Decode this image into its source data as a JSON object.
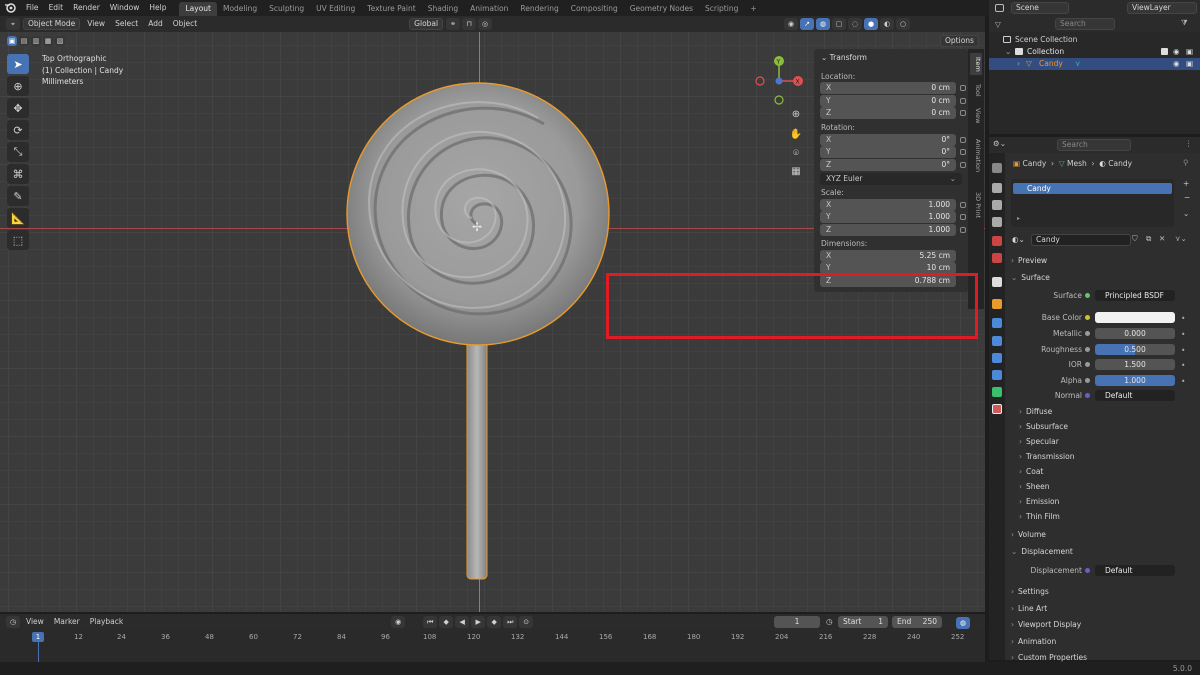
{
  "topbar": {
    "menus": [
      "File",
      "Edit",
      "Render",
      "Window",
      "Help"
    ],
    "workspaces": [
      "Layout",
      "Modeling",
      "Sculpting",
      "UV Editing",
      "Texture Paint",
      "Shading",
      "Animation",
      "Rendering",
      "Compositing",
      "Geometry Nodes",
      "Scripting"
    ],
    "add_tab": "+",
    "scene": "Scene",
    "view_layer": "ViewLayer"
  },
  "viewport_header": {
    "mode": "Object Mode",
    "menus": [
      "View",
      "Select",
      "Add",
      "Object"
    ],
    "orientation": "Global",
    "options": "Options"
  },
  "viewport": {
    "view_name": "Top Orthographic",
    "collection_info": "(1) Collection | Candy",
    "units": "Millimeters",
    "gizmo": {
      "x": "X",
      "y": "Y"
    }
  },
  "npanel": {
    "title": "Transform",
    "location_label": "Location:",
    "location": [
      {
        "axis": "X",
        "value": "0 cm"
      },
      {
        "axis": "Y",
        "value": "0 cm"
      },
      {
        "axis": "Z",
        "value": "0 cm"
      }
    ],
    "rotation_label": "Rotation:",
    "rotation": [
      {
        "axis": "X",
        "value": "0°"
      },
      {
        "axis": "Y",
        "value": "0°"
      },
      {
        "axis": "Z",
        "value": "0°"
      }
    ],
    "rotation_mode": "XYZ Euler",
    "scale_label": "Scale:",
    "scale": [
      {
        "axis": "X",
        "value": "1.000"
      },
      {
        "axis": "Y",
        "value": "1.000"
      },
      {
        "axis": "Z",
        "value": "1.000"
      }
    ],
    "dimensions_label": "Dimensions:",
    "dimensions": [
      {
        "axis": "X",
        "value": "5.25 cm"
      },
      {
        "axis": "Y",
        "value": "10 cm"
      },
      {
        "axis": "Z",
        "value": "0.788 cm"
      }
    ],
    "tabs": [
      "Item",
      "Tool",
      "View",
      "Animation",
      "3D Print"
    ]
  },
  "outliner": {
    "search_placeholder": "Search",
    "scene_collection": "Scene Collection",
    "collection": "Collection",
    "object": "Candy"
  },
  "properties": {
    "search_placeholder": "Search",
    "breadcrumb": [
      "Candy",
      "Mesh",
      "Candy"
    ],
    "slot": "Candy",
    "material": "Candy",
    "sections_top": [
      "Preview",
      "Surface"
    ],
    "surface": {
      "label": "Surface",
      "value": "Principled BSDF"
    },
    "rows": [
      {
        "label": "Base Color",
        "value": ""
      },
      {
        "label": "Metallic",
        "value": "0.000"
      },
      {
        "label": "Roughness",
        "value": "0.500"
      },
      {
        "label": "IOR",
        "value": "1.500"
      },
      {
        "label": "Alpha",
        "value": "1.000"
      },
      {
        "label": "Normal",
        "value": "Default"
      }
    ],
    "subsections": [
      "Diffuse",
      "Subsurface",
      "Specular",
      "Transmission",
      "Coat",
      "Sheen",
      "Emission",
      "Thin Film"
    ],
    "volume": "Volume",
    "displacement_section": "Displacement",
    "displacement": {
      "label": "Displacement",
      "value": "Default"
    },
    "more_sections": [
      "Settings",
      "Line Art",
      "Viewport Display",
      "Animation",
      "Custom Properties"
    ]
  },
  "timeline": {
    "menus": [
      "View",
      "Marker",
      "Playback"
    ],
    "current_frame": "1",
    "start_label": "Start",
    "start": "1",
    "end_label": "End",
    "end": "250",
    "ticks": [
      "12",
      "24",
      "36",
      "48",
      "60",
      "72",
      "84",
      "96",
      "108",
      "120",
      "132",
      "144",
      "156",
      "168",
      "180",
      "192",
      "204",
      "216",
      "228",
      "240",
      "252"
    ]
  },
  "status": {
    "version": "5.0.0"
  },
  "colors": {
    "accent": "#4772b3",
    "highlight": "#e01b24",
    "selection_outline": "#e89b2c"
  }
}
